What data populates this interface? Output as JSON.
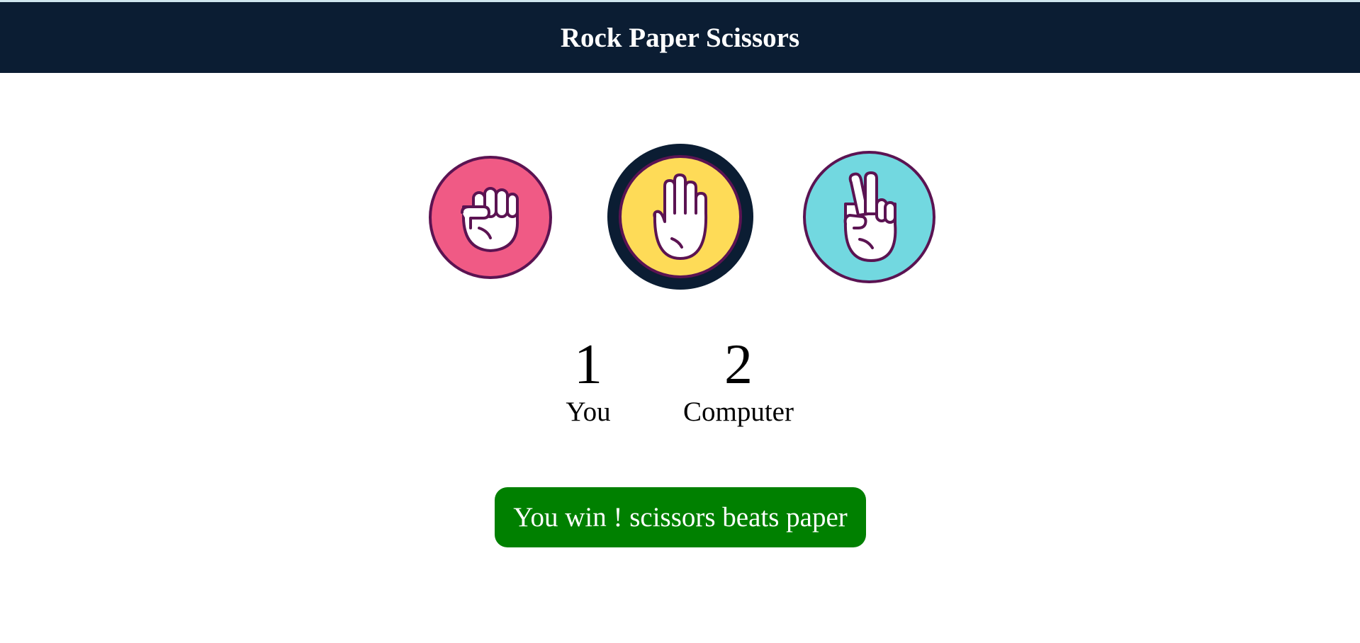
{
  "header": {
    "title": "Rock Paper Scissors"
  },
  "choices": [
    {
      "name": "rock",
      "icon": "fist-icon",
      "color": "#f05a85"
    },
    {
      "name": "paper",
      "icon": "open-hand-icon",
      "color": "#fedb57",
      "selected": true
    },
    {
      "name": "scissors",
      "icon": "peace-hand-icon",
      "color": "#72d8e0"
    }
  ],
  "colors": {
    "header_bg": "#0b1d33",
    "outline": "#5b1352",
    "result_bg": "#008000"
  },
  "scores": {
    "you": {
      "value": "1",
      "label": "You"
    },
    "computer": {
      "value": "2",
      "label": "Computer"
    }
  },
  "result": {
    "message": "You win ! scissors beats paper"
  }
}
